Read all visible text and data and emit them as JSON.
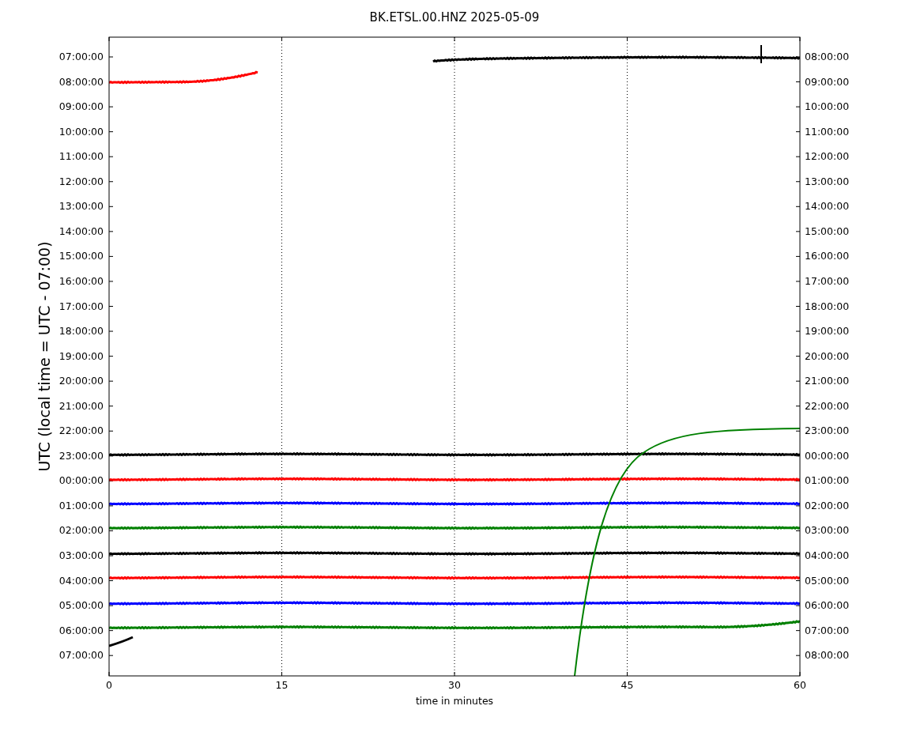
{
  "title": "BK.ETSL.00.HNZ 2025-05-09",
  "ylabel": "UTC (local time = UTC - 07:00)",
  "xlabel": "time in minutes",
  "left_ticks": [
    "07:00:00",
    "08:00:00",
    "09:00:00",
    "10:00:00",
    "11:00:00",
    "12:00:00",
    "13:00:00",
    "14:00:00",
    "15:00:00",
    "16:00:00",
    "17:00:00",
    "18:00:00",
    "19:00:00",
    "20:00:00",
    "21:00:00",
    "22:00:00",
    "23:00:00",
    "00:00:00",
    "01:00:00",
    "02:00:00",
    "03:00:00",
    "04:00:00",
    "05:00:00",
    "06:00:00",
    "07:00:00"
  ],
  "right_ticks": [
    "08:00:00",
    "09:00:00",
    "10:00:00",
    "11:00:00",
    "12:00:00",
    "13:00:00",
    "14:00:00",
    "15:00:00",
    "16:00:00",
    "17:00:00",
    "18:00:00",
    "19:00:00",
    "20:00:00",
    "21:00:00",
    "22:00:00",
    "23:00:00",
    "00:00:00",
    "01:00:00",
    "02:00:00",
    "03:00:00",
    "04:00:00",
    "05:00:00",
    "06:00:00",
    "07:00:00",
    "08:00:00"
  ],
  "x_ticks": [
    "0",
    "15",
    "30",
    "45",
    "60"
  ],
  "traces": [
    {
      "color": "#000000"
    },
    {
      "color": "#ff0000"
    },
    {
      "color": "#000000"
    },
    {
      "color": "#ff0000"
    },
    {
      "color": "#0000ff"
    },
    {
      "color": "#008000"
    },
    {
      "color": "#000000"
    },
    {
      "color": "#ff0000"
    },
    {
      "color": "#0000ff"
    },
    {
      "color": "#008000"
    },
    {
      "color": "#000000"
    },
    {
      "color": "#008000"
    }
  ]
}
